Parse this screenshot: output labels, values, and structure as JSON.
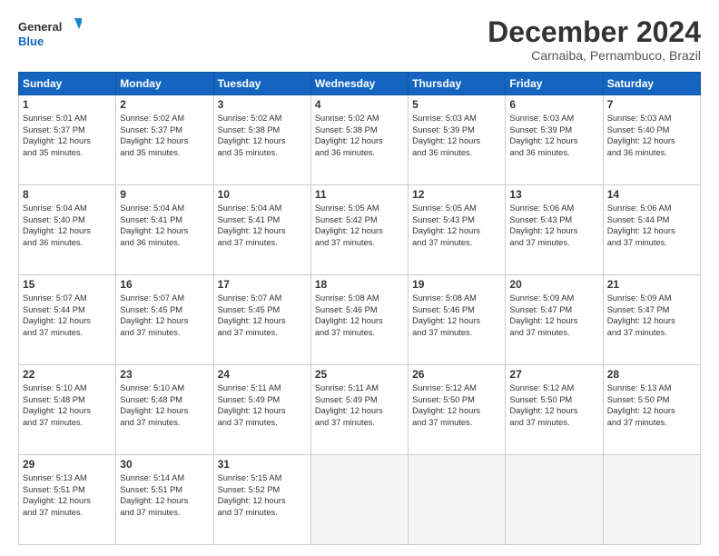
{
  "logo": {
    "line1": "General",
    "line2": "Blue"
  },
  "title": "December 2024",
  "subtitle": "Carnaiba, Pernambuco, Brazil",
  "days_of_week": [
    "Sunday",
    "Monday",
    "Tuesday",
    "Wednesday",
    "Thursday",
    "Friday",
    "Saturday"
  ],
  "weeks": [
    [
      {
        "day": 1,
        "text": "Sunrise: 5:01 AM\nSunset: 5:37 PM\nDaylight: 12 hours\nand 35 minutes."
      },
      {
        "day": 2,
        "text": "Sunrise: 5:02 AM\nSunset: 5:37 PM\nDaylight: 12 hours\nand 35 minutes."
      },
      {
        "day": 3,
        "text": "Sunrise: 5:02 AM\nSunset: 5:38 PM\nDaylight: 12 hours\nand 35 minutes."
      },
      {
        "day": 4,
        "text": "Sunrise: 5:02 AM\nSunset: 5:38 PM\nDaylight: 12 hours\nand 36 minutes."
      },
      {
        "day": 5,
        "text": "Sunrise: 5:03 AM\nSunset: 5:39 PM\nDaylight: 12 hours\nand 36 minutes."
      },
      {
        "day": 6,
        "text": "Sunrise: 5:03 AM\nSunset: 5:39 PM\nDaylight: 12 hours\nand 36 minutes."
      },
      {
        "day": 7,
        "text": "Sunrise: 5:03 AM\nSunset: 5:40 PM\nDaylight: 12 hours\nand 36 minutes."
      }
    ],
    [
      {
        "day": 8,
        "text": "Sunrise: 5:04 AM\nSunset: 5:40 PM\nDaylight: 12 hours\nand 36 minutes."
      },
      {
        "day": 9,
        "text": "Sunrise: 5:04 AM\nSunset: 5:41 PM\nDaylight: 12 hours\nand 36 minutes."
      },
      {
        "day": 10,
        "text": "Sunrise: 5:04 AM\nSunset: 5:41 PM\nDaylight: 12 hours\nand 37 minutes."
      },
      {
        "day": 11,
        "text": "Sunrise: 5:05 AM\nSunset: 5:42 PM\nDaylight: 12 hours\nand 37 minutes."
      },
      {
        "day": 12,
        "text": "Sunrise: 5:05 AM\nSunset: 5:43 PM\nDaylight: 12 hours\nand 37 minutes."
      },
      {
        "day": 13,
        "text": "Sunrise: 5:06 AM\nSunset: 5:43 PM\nDaylight: 12 hours\nand 37 minutes."
      },
      {
        "day": 14,
        "text": "Sunrise: 5:06 AM\nSunset: 5:44 PM\nDaylight: 12 hours\nand 37 minutes."
      }
    ],
    [
      {
        "day": 15,
        "text": "Sunrise: 5:07 AM\nSunset: 5:44 PM\nDaylight: 12 hours\nand 37 minutes."
      },
      {
        "day": 16,
        "text": "Sunrise: 5:07 AM\nSunset: 5:45 PM\nDaylight: 12 hours\nand 37 minutes."
      },
      {
        "day": 17,
        "text": "Sunrise: 5:07 AM\nSunset: 5:45 PM\nDaylight: 12 hours\nand 37 minutes."
      },
      {
        "day": 18,
        "text": "Sunrise: 5:08 AM\nSunset: 5:46 PM\nDaylight: 12 hours\nand 37 minutes."
      },
      {
        "day": 19,
        "text": "Sunrise: 5:08 AM\nSunset: 5:46 PM\nDaylight: 12 hours\nand 37 minutes."
      },
      {
        "day": 20,
        "text": "Sunrise: 5:09 AM\nSunset: 5:47 PM\nDaylight: 12 hours\nand 37 minutes."
      },
      {
        "day": 21,
        "text": "Sunrise: 5:09 AM\nSunset: 5:47 PM\nDaylight: 12 hours\nand 37 minutes."
      }
    ],
    [
      {
        "day": 22,
        "text": "Sunrise: 5:10 AM\nSunset: 5:48 PM\nDaylight: 12 hours\nand 37 minutes."
      },
      {
        "day": 23,
        "text": "Sunrise: 5:10 AM\nSunset: 5:48 PM\nDaylight: 12 hours\nand 37 minutes."
      },
      {
        "day": 24,
        "text": "Sunrise: 5:11 AM\nSunset: 5:49 PM\nDaylight: 12 hours\nand 37 minutes."
      },
      {
        "day": 25,
        "text": "Sunrise: 5:11 AM\nSunset: 5:49 PM\nDaylight: 12 hours\nand 37 minutes."
      },
      {
        "day": 26,
        "text": "Sunrise: 5:12 AM\nSunset: 5:50 PM\nDaylight: 12 hours\nand 37 minutes."
      },
      {
        "day": 27,
        "text": "Sunrise: 5:12 AM\nSunset: 5:50 PM\nDaylight: 12 hours\nand 37 minutes."
      },
      {
        "day": 28,
        "text": "Sunrise: 5:13 AM\nSunset: 5:50 PM\nDaylight: 12 hours\nand 37 minutes."
      }
    ],
    [
      {
        "day": 29,
        "text": "Sunrise: 5:13 AM\nSunset: 5:51 PM\nDaylight: 12 hours\nand 37 minutes."
      },
      {
        "day": 30,
        "text": "Sunrise: 5:14 AM\nSunset: 5:51 PM\nDaylight: 12 hours\nand 37 minutes."
      },
      {
        "day": 31,
        "text": "Sunrise: 5:15 AM\nSunset: 5:52 PM\nDaylight: 12 hours\nand 37 minutes."
      },
      null,
      null,
      null,
      null
    ]
  ]
}
